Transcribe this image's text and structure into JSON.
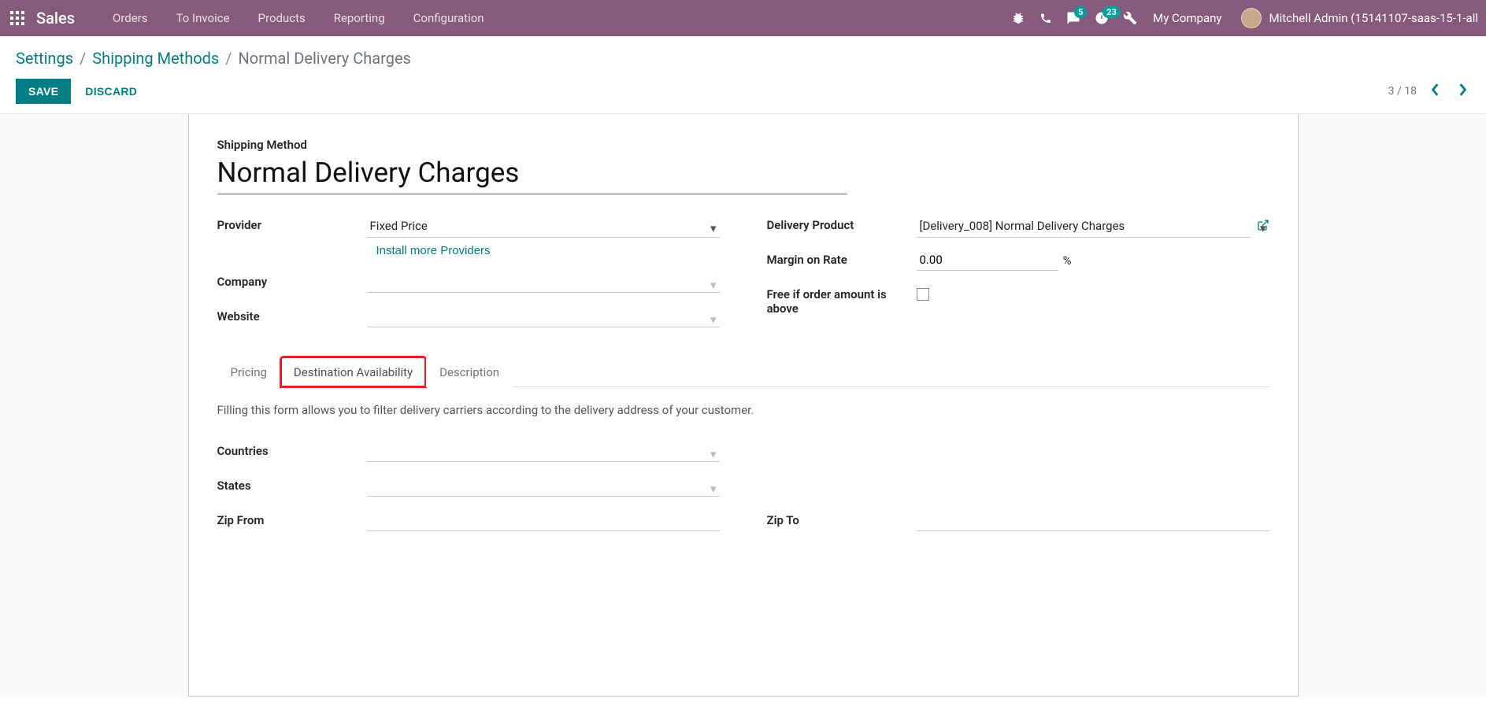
{
  "topbar": {
    "app_title": "Sales",
    "menu": [
      "Orders",
      "To Invoice",
      "Products",
      "Reporting",
      "Configuration"
    ],
    "messages_badge": "5",
    "activities_badge": "23",
    "company": "My Company",
    "username": "Mitchell Admin (15141107-saas-15-1-all"
  },
  "breadcrumbs": {
    "parts": [
      "Settings",
      "Shipping Methods"
    ],
    "current": "Normal Delivery Charges",
    "sep": "/"
  },
  "actions": {
    "save": "SAVE",
    "discard": "DISCARD"
  },
  "pager": {
    "text": "3 / 18"
  },
  "form": {
    "title_label": "Shipping Method",
    "title_value": "Normal Delivery Charges",
    "labels": {
      "provider": "Provider",
      "company": "Company",
      "website": "Website",
      "delivery_product": "Delivery Product",
      "margin": "Margin on Rate",
      "free_if": "Free if order amount is above"
    },
    "values": {
      "provider": "Fixed Price",
      "install_more": "Install more Providers",
      "delivery_product": "[Delivery_008] Normal Delivery Charges",
      "margin": "0.00",
      "pct": "%"
    }
  },
  "tabs": {
    "pricing": "Pricing",
    "dest": "Destination Availability",
    "desc": "Description"
  },
  "dest_tab": {
    "helper": "Filling this form allows you to filter delivery carriers according to the delivery address of your customer.",
    "labels": {
      "countries": "Countries",
      "states": "States",
      "zip_from": "Zip From",
      "zip_to": "Zip To"
    }
  }
}
